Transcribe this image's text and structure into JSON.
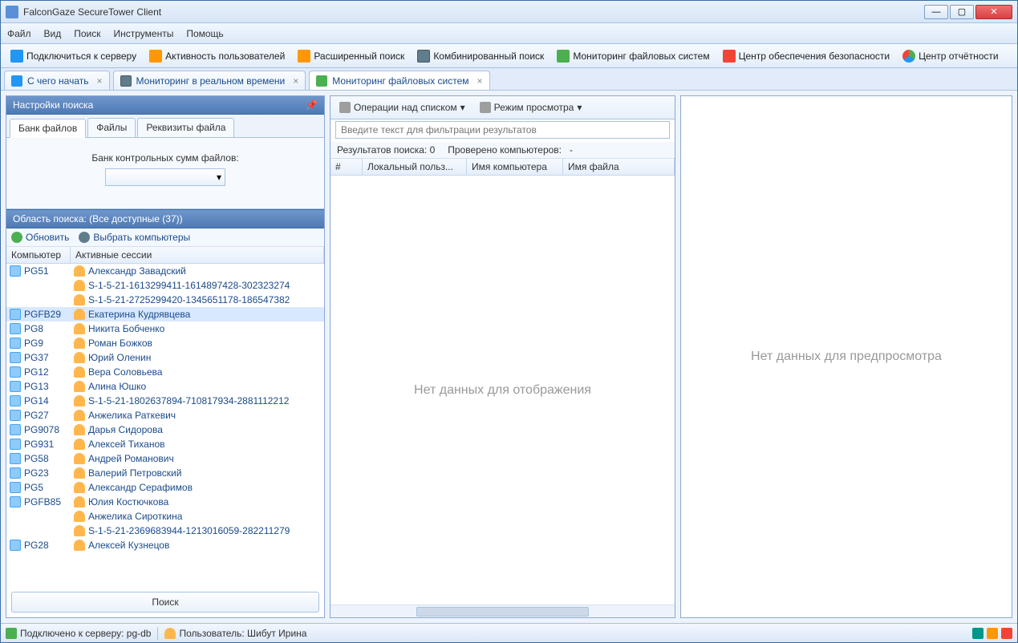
{
  "window": {
    "title": "FalconGaze SecureTower Client"
  },
  "menu": [
    "Файл",
    "Вид",
    "Поиск",
    "Инструменты",
    "Помощь"
  ],
  "toolbar": [
    {
      "label": "Подключиться к серверу",
      "icon": "i-blue"
    },
    {
      "label": "Активность пользователей",
      "icon": "i-orange"
    },
    {
      "label": "Расширенный поиск",
      "icon": "i-orange"
    },
    {
      "label": "Комбинированный поиск",
      "icon": "i-monitor"
    },
    {
      "label": "Мониторинг файловых систем",
      "icon": "i-green"
    },
    {
      "label": "Центр обеспечения безопасности",
      "icon": "i-red"
    },
    {
      "label": "Центр отчётности",
      "icon": "i-pie"
    }
  ],
  "tabs": [
    {
      "label": "С чего начать",
      "icon": "i-blue"
    },
    {
      "label": "Мониторинг в реальном времени",
      "icon": "i-monitor"
    },
    {
      "label": "Мониторинг файловых систем",
      "icon": "i-green",
      "active": true
    }
  ],
  "leftPanel": {
    "title": "Настройки поиска",
    "subtabs": [
      "Банк файлов",
      "Файлы",
      "Реквизиты файла"
    ],
    "bankLabel": "Банк контрольных сумм файлов:",
    "scopeTitle": "Область поиска: (Все доступные (37))",
    "refresh": "Обновить",
    "pick": "Выбрать компьютеры",
    "cols": [
      "Компьютер",
      "Активные сессии"
    ],
    "searchBtn": "Поиск",
    "rows": [
      {
        "comp": "PG51",
        "sessions": [
          "Александр Завадский",
          "S-1-5-21-1613299411-1614897428-302323274",
          "S-1-5-21-2725299420-1345651178-186547382"
        ]
      },
      {
        "comp": "PGFB29",
        "sessions": [
          "Екатерина Кудрявцева"
        ],
        "selected": true
      },
      {
        "comp": "PG8",
        "sessions": [
          "Никита Бобченко"
        ]
      },
      {
        "comp": "PG9",
        "sessions": [
          "Роман Божков"
        ]
      },
      {
        "comp": "PG37",
        "sessions": [
          "Юрий Оленин"
        ]
      },
      {
        "comp": "PG12",
        "sessions": [
          "Вера Соловьева"
        ]
      },
      {
        "comp": "PG13",
        "sessions": [
          "Алина Юшко"
        ]
      },
      {
        "comp": "PG14",
        "sessions": [
          "S-1-5-21-1802637894-710817934-2881112212"
        ]
      },
      {
        "comp": "PG27",
        "sessions": [
          "Анжелика Раткевич"
        ]
      },
      {
        "comp": "PG9078",
        "sessions": [
          "Дарья Сидорова"
        ]
      },
      {
        "comp": "PG931",
        "sessions": [
          "Алексей Тиханов"
        ]
      },
      {
        "comp": "PG58",
        "sessions": [
          "Андрей Романович"
        ]
      },
      {
        "comp": "PG23",
        "sessions": [
          "Валерий Петровский"
        ]
      },
      {
        "comp": "PG5",
        "sessions": [
          "Александр Серафимов"
        ]
      },
      {
        "comp": "PGFB85",
        "sessions": [
          "Юлия Костючкова",
          "Анжелика Сироткина",
          "S-1-5-21-2369683944-1213016059-282211279"
        ]
      },
      {
        "comp": "PG28",
        "sessions": [
          "Алексей Кузнецов"
        ]
      }
    ]
  },
  "midPanel": {
    "opsLabel": "Операции над списком",
    "viewLabel": "Режим просмотра",
    "filterPlaceholder": "Введите текст для фильтрации результатов",
    "resultsLabel": "Результатов поиска:",
    "resultsCount": "0",
    "checkedLabel": "Проверено компьютеров:",
    "checkedCount": "-",
    "cols": [
      "#",
      "Локальный польз...",
      "Имя компьютера",
      "Имя файла"
    ],
    "noData": "Нет данных для отображения"
  },
  "rightPanel": {
    "noData": "Нет данных для предпросмотра"
  },
  "status": {
    "connected": "Подключено к серверу: pg-db",
    "user": "Пользователь: Шибут Ирина"
  }
}
